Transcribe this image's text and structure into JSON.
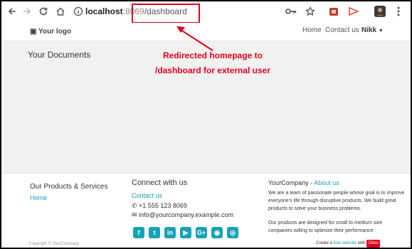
{
  "browser": {
    "url_host": "localhost",
    "url_port": ":8069",
    "url_path": "/dashboard"
  },
  "site": {
    "logo": "Your logo",
    "nav": [
      "Home",
      "Contact us"
    ],
    "user": "Nikk"
  },
  "main": {
    "title": "Your Documents",
    "annotation_line1": "Redirected homepage to",
    "annotation_line2": "/dashboard for external user"
  },
  "footer": {
    "products_title": "Our Products & Services",
    "products_link": "Home",
    "connect_title": "Connect with us",
    "contact_link": "Contact us",
    "phone": "+1 555 123 8069",
    "email": "info@yourcompany.example.com",
    "company": "YourCompany",
    "about_link": "About us",
    "about_text1": "We are a team of passionate people whose goal is to improve everyone's life through disruptive products. We build great products to solve your business problems.",
    "about_text2": "Our products are designed for small to medium size companies willing to optimize their performance.",
    "copyright": "Copyright © YourCompany",
    "create_prefix": "Create a",
    "create_link": "free website",
    "create_with": "with",
    "odoo_badge": "Odoo"
  }
}
